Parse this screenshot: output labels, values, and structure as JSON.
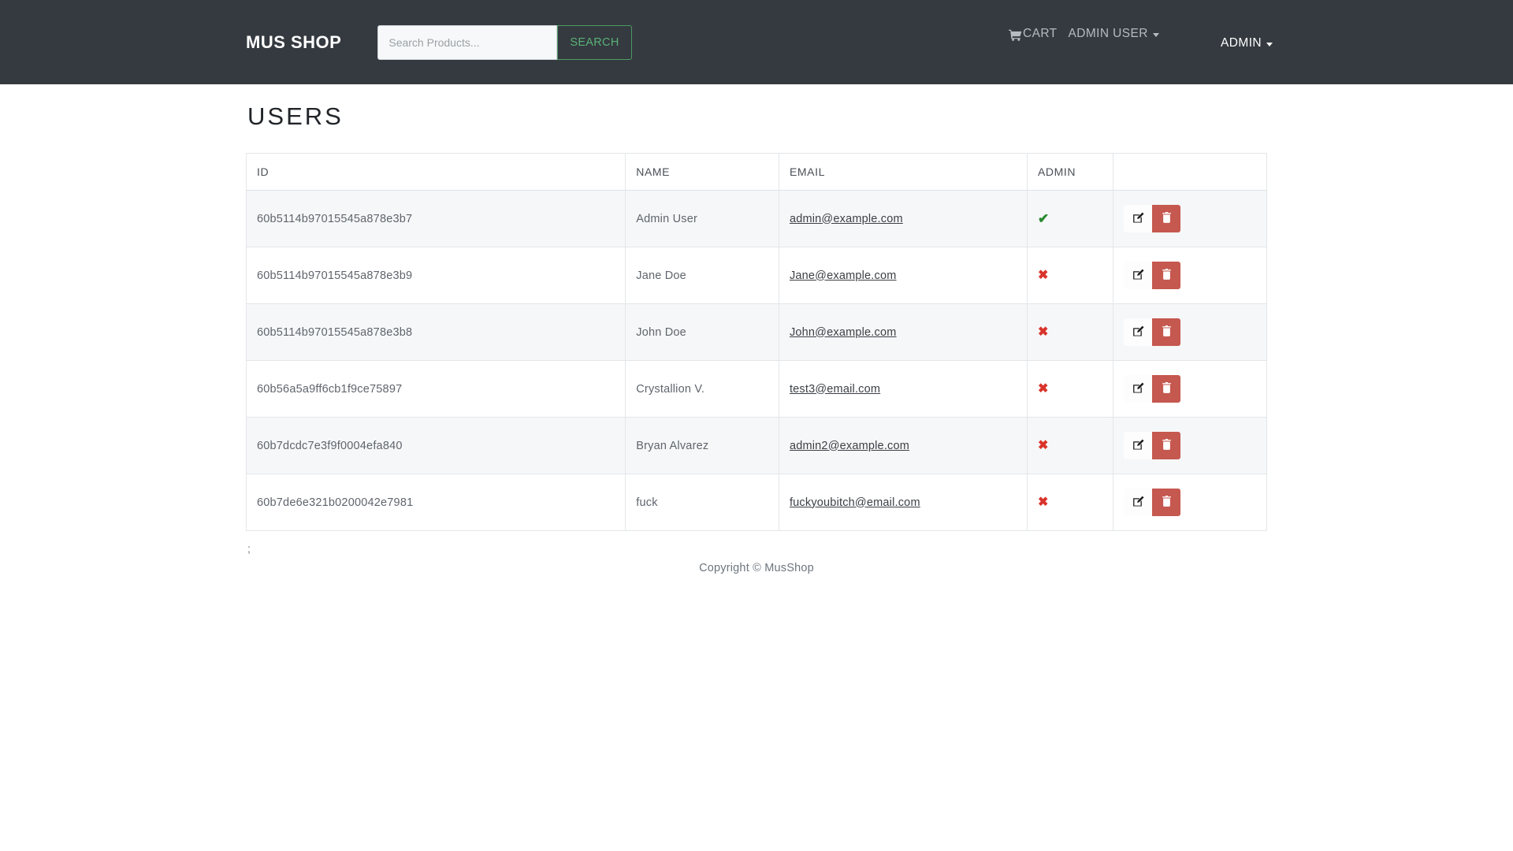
{
  "navbar": {
    "brand": "MUS SHOP",
    "search": {
      "placeholder": "Search Products...",
      "value": "",
      "button_label": "Search"
    },
    "cart_label": "CART",
    "user_menu_label": "Admin User",
    "admin_menu_label": "Admin"
  },
  "main": {
    "page_title": "Users",
    "table": {
      "headers": [
        "ID",
        "Name",
        "Email",
        "Admin",
        ""
      ],
      "rows": [
        {
          "id": "60b5114b97015545a878e3b7",
          "name": "Admin User",
          "email": "admin@example.com",
          "admin": true,
          "admin_glyph": "✔",
          "edit_label": "Edit",
          "delete_label": "Delete"
        },
        {
          "id": "60b5114b97015545a878e3b9",
          "name": "Jane Doe",
          "email": "Jane@example.com",
          "admin": false,
          "admin_glyph": "✖",
          "edit_label": "Edit",
          "delete_label": "Delete"
        },
        {
          "id": "60b5114b97015545a878e3b8",
          "name": "John Doe",
          "email": "John@example.com",
          "admin": false,
          "admin_glyph": "✖",
          "edit_label": "Edit",
          "delete_label": "Delete"
        },
        {
          "id": "60b56a5a9ff6cb1f9ce75897",
          "name": "Crystallion V.",
          "email": "test3@email.com",
          "admin": false,
          "admin_glyph": "✖",
          "edit_label": "Edit",
          "delete_label": "Delete"
        },
        {
          "id": "60b7dcdc7e3f9f0004efa840",
          "name": "Bryan Alvarez",
          "email": "admin2@example.com",
          "admin": false,
          "admin_glyph": "✖",
          "edit_label": "Edit",
          "delete_label": "Delete"
        },
        {
          "id": "60b7de6e321b0200042e7981",
          "name": "fuck",
          "email": "fuckyoubitch@email.com",
          "admin": false,
          "admin_glyph": "✖",
          "edit_label": "Edit",
          "delete_label": "Delete"
        }
      ]
    },
    "stray_text": ";"
  },
  "footer": {
    "copyright": "Copyright © MusShop"
  },
  "colors": {
    "navbar_bg": "#343a40",
    "search_button_border": "#4e9a62",
    "search_button_text": "#5cb176",
    "delete_button_bg": "#c5584f",
    "admin_yes": "#27892f",
    "admin_no": "#d9342b",
    "row_stripe": "#f6f7f8"
  }
}
